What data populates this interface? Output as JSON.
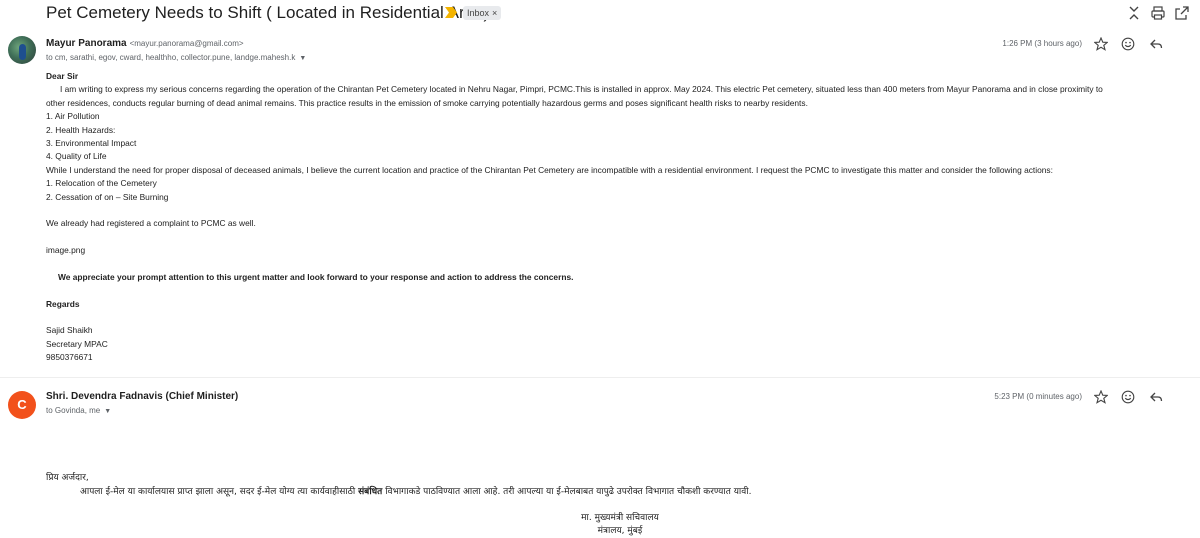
{
  "thread": {
    "subject": "Pet Cemetery Needs to Shift ( Located in Residential Area)",
    "label": "Inbox",
    "label_close": "×"
  },
  "icons": {
    "collapse": "collapse-icon",
    "print": "print-icon",
    "open_new_window": "open-in-new-icon",
    "star": "star-icon",
    "emoji": "emoji-icon",
    "reply": "reply-icon"
  },
  "colors": {
    "important_marker": "#f4b400",
    "avatar_letter_bg": "#f2511b"
  },
  "message1": {
    "sender_name": "Mayur Panorama",
    "sender_email": "<mayur.panorama@gmail.com>",
    "recipients": "to cm, sarathi, egov, cward, healthho, collector.pune, landge.mahesh.k",
    "time": "1:26 PM (3 hours ago)",
    "greeting": "Dear Sir",
    "para1_line1": "I am writing to express my serious concerns regarding the operation of the Chirantan Pet Cemetery located in Nehru Nagar, Pimpri, PCMC.This is installed in approx. May 2024. This electric Pet cemetery, situated less than 400 meters from Mayur Panorama and in close proximity to",
    "para1_line2": "other residences, conducts regular burning of dead animal remains. This practice results in the emission of smoke carrying potentially hazardous germs and poses significant health risks to nearby residents.",
    "concerns": [
      "1. Air Pollution",
      "2. Health Hazards:",
      "3. Environmental Impact",
      "4. Quality of Life"
    ],
    "para2": "While I understand the need for proper disposal of deceased animals, I believe the current location and practice of the Chirantan Pet Cemetery are incompatible with a residential environment. I request the PCMC to investigate this  matter and consider the following actions:",
    "actions": [
      "1. Relocation of the Cemetery",
      "2. Cessation of on – Site Burning"
    ],
    "complaint": "We already had registered a complaint to PCMC as well.",
    "image_alt": "image.png",
    "appreciation": "We appreciate your prompt attention to this urgent matter and look forward to your response and action to address the concerns.",
    "regards": "Regards",
    "signature": [
      "Sajid Shaikh",
      "Secretary MPAC",
      "9850376671"
    ]
  },
  "message2": {
    "avatar_letter": "C",
    "sender_name": "Shri. Devendra Fadnavis (Chief Minister)",
    "recipients": "to Govinda, me",
    "time": "5:23 PM (0 minutes ago)",
    "salutation": "प्रिय अर्जदार,",
    "body_before": "आपला ई-मेल या कार्यालयास प्राप्त झाला असून, सदर ई-मेल योग्य त्या कार्यवाहीसाठी ",
    "body_bold": "संबंधित",
    "body_after": " विभागाकडे पाठविण्यात आला आहे. तरी आपल्या या ई-मेलबाबत यापुढे उपरोक्त विभागात चौकशी करण्यात यावी.",
    "sign_line1": "मा. मुख्यमंत्री सचिवालय",
    "sign_line2": "मंत्रालय, मुंबई"
  }
}
